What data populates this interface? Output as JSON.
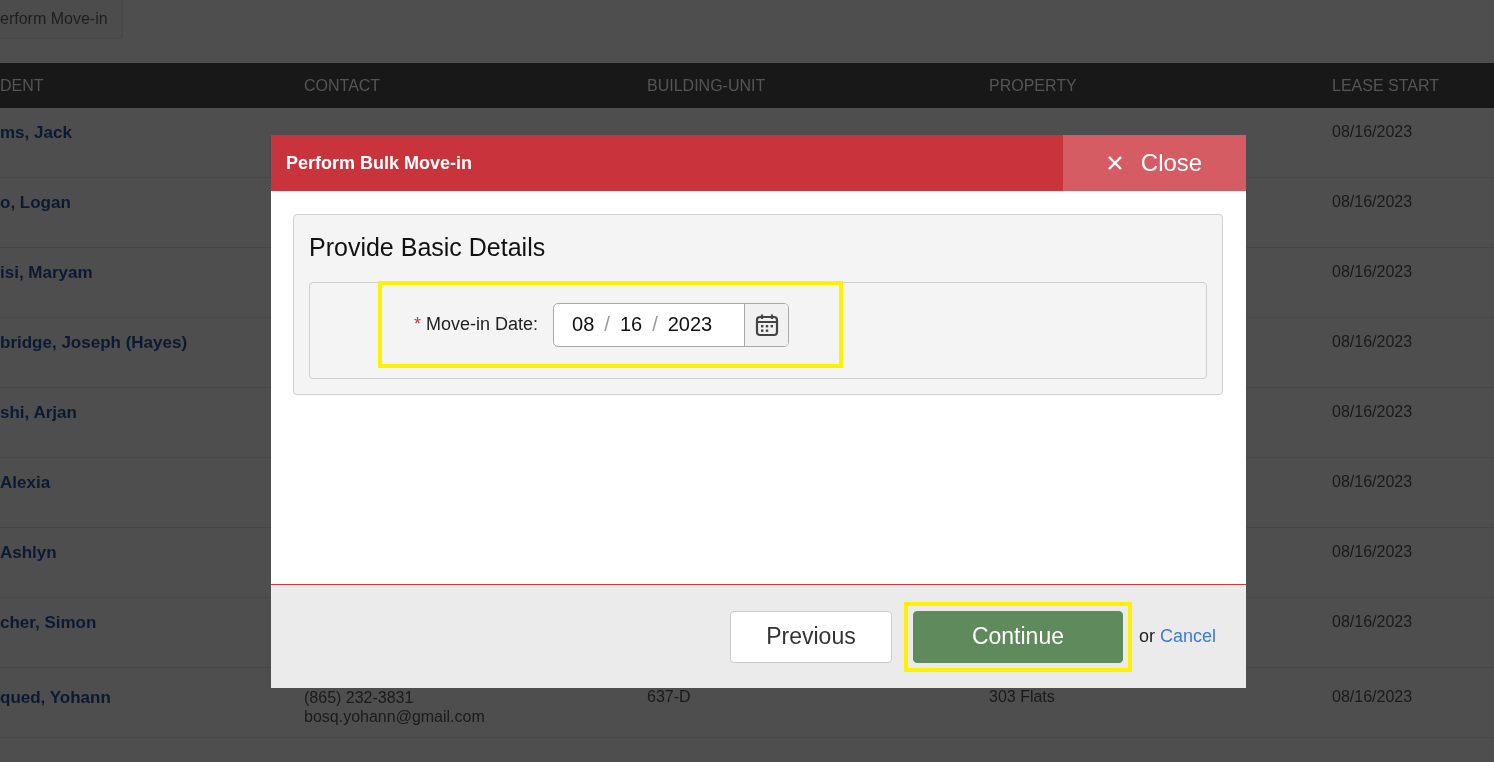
{
  "page_button": "erform Move-in",
  "table": {
    "columns": [
      "DENT",
      "CONTACT",
      "BUILDING-UNIT",
      "PROPERTY",
      "LEASE START"
    ],
    "rows": [
      {
        "resident": "ms, Jack",
        "lease_start": "08/16/2023"
      },
      {
        "resident": "o, Logan",
        "lease_start": "08/16/2023"
      },
      {
        "resident": "isi, Maryam",
        "lease_start": "08/16/2023"
      },
      {
        "resident": "bridge, Joseph (Hayes)",
        "lease_start": "08/16/2023"
      },
      {
        "resident": "shi, Arjan",
        "lease_start": "08/16/2023"
      },
      {
        "resident": "Alexia",
        "lease_start": "08/16/2023"
      },
      {
        "resident": "Ashlyn",
        "lease_start": "08/16/2023"
      },
      {
        "resident": "cher, Simon",
        "lease_start": "08/16/2023"
      },
      {
        "resident": "qued, Yohann",
        "contact": [
          "(865) 232-3831",
          "bosq.yohann@gmail.com"
        ],
        "unit": "637-D",
        "property": "303 Flats",
        "lease_start": "08/16/2023"
      }
    ]
  },
  "dialog": {
    "title": "Perform Bulk Move-in",
    "close_label": "Close",
    "section_title": "Provide Basic Details",
    "date_field": {
      "required_mark": "*",
      "label": "Move-in Date:",
      "month": "08",
      "day": "16",
      "year": "2023",
      "separators": [
        "/",
        "/"
      ],
      "highlighted": true
    },
    "buttons": [
      {
        "kind": "secondary",
        "label": "Previous",
        "highlighted": false
      },
      {
        "kind": "primary",
        "label": "Continue",
        "highlighted": true
      }
    ],
    "or_text": "or",
    "cancel_link": "Cancel"
  }
}
